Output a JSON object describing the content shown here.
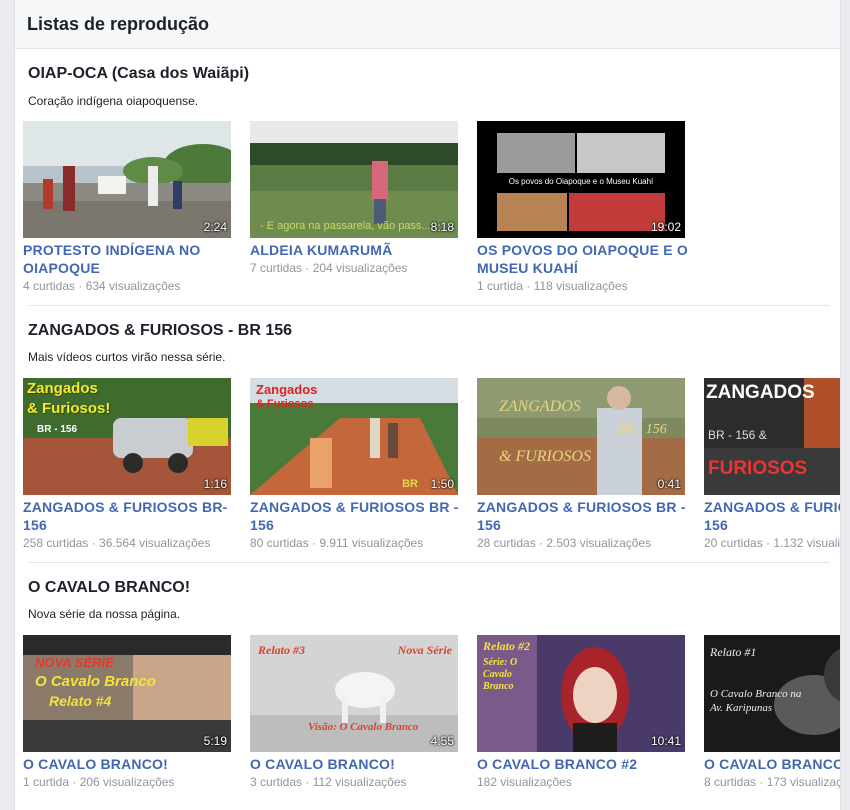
{
  "header": {
    "title": "Listas de reprodução"
  },
  "sections": [
    {
      "title": "OIAP-OCA (Casa dos Waiãpi)",
      "description": "Coração indígena oiapoquense.",
      "videos": [
        {
          "line1": "PROTESTO INDÍGENA NO",
          "line2": "OIAPOQUE",
          "meta": "4 curtidas · 634 visualizações",
          "duration": "2:24"
        },
        {
          "line1": "ALDEIA KUMARUMÃ",
          "line2": "",
          "meta": "7 curtidas · 204 visualizações",
          "duration": "8:18",
          "caption": "- E agora na passarela, vão pass..."
        },
        {
          "line1": "OS POVOS DO OIAPOQUE E O",
          "line2": "MUSEU KUAHÍ",
          "meta": "1 curtida · 118 visualizações",
          "duration": "19:02",
          "caption": "Os povos do Oiapoque e o Museu Kuahí"
        }
      ]
    },
    {
      "title": "ZANGADOS & FURIOSOS - BR 156",
      "description": "Mais vídeos curtos virão nessa série.",
      "videos": [
        {
          "line1": "ZANGADOS & FURIOSOS BR-",
          "line2": "156",
          "meta": "258 curtidas · 36.564 visualizações",
          "duration": "1:16",
          "art1": "Zangados",
          "art2": "& Furiosos!",
          "art3": "BR - 156"
        },
        {
          "line1": "ZANGADOS & FURIOSOS BR -",
          "line2": "156",
          "meta": "80 curtidas · 9.911 visualizações",
          "duration": "1:50",
          "art1": "Zangados",
          "art2": "& Furiosos",
          "art3": "BR"
        },
        {
          "line1": "ZANGADOS & FURIOSOS BR -",
          "line2": "156",
          "meta": "28 curtidas · 2.503 visualizações",
          "duration": "0:41",
          "art1": "ZANGADOS",
          "art2": "& FURIOSOS",
          "art3": "BR - 156"
        },
        {
          "line1": "ZANGADOS & FURIOS",
          "line2": "156",
          "meta": "20 curtidas · 1.132 visuali",
          "duration": "",
          "art1": "ZANGADOS",
          "art2": "BR - 156  &",
          "art3": "FURIOSOS"
        }
      ]
    },
    {
      "title": "O CAVALO BRANCO!",
      "description": "Nova série da nossa página.",
      "videos": [
        {
          "line1": "O CAVALO BRANCO!",
          "line2": "",
          "meta": "1 curtida · 206 visualizações",
          "duration": "5:19",
          "art1": "NOVA SÉRIE",
          "art2": "O Cavalo Branco",
          "art3": "Relato #4"
        },
        {
          "line1": "O CAVALO BRANCO!",
          "line2": "",
          "meta": "3 curtidas · 112 visualizações",
          "duration": "4:55",
          "art1": "Relato #3",
          "art2": "Nova Série",
          "art3": "Visão: O Cavalo Branco"
        },
        {
          "line1": "O CAVALO BRANCO #2",
          "line2": "",
          "meta": "182 visualizações",
          "duration": "10:41",
          "art1": "Relato #2",
          "art2": "Série: O Cavalo Branco",
          "art3": ""
        },
        {
          "line1": "O CAVALO BRANCO!",
          "line2": "",
          "meta": "8 curtidas · 173 visualizaç",
          "duration": "",
          "art1": "Relato #1",
          "art2": "O Cavalo Branco na Av. Karipunas",
          "art3": ""
        }
      ]
    }
  ]
}
